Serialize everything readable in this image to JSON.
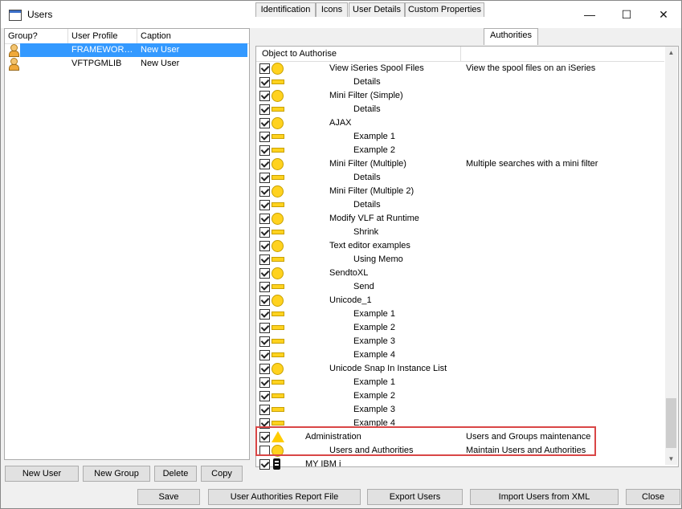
{
  "window": {
    "title": "Users",
    "minimize_glyph": "—",
    "maximize_glyph": "☐",
    "close_glyph": "✕"
  },
  "users_list": {
    "columns": [
      "Group?",
      "User Profile",
      "Caption"
    ],
    "rows": [
      {
        "profile": "FRAMEWOR…",
        "caption": "New User",
        "selected": true
      },
      {
        "profile": "VFTPGMLIB",
        "caption": "New User",
        "selected": false
      }
    ]
  },
  "left_buttons": {
    "new_user": "New User",
    "new_group": "New Group",
    "delete": "Delete",
    "copy": "Copy"
  },
  "tabs": [
    "Identification",
    "Icons",
    "User Details",
    "Custom Properties",
    "Authorities"
  ],
  "active_tab": "Authorities",
  "authorities": {
    "header": "Object to Authorise",
    "rows": [
      {
        "label": "View iSeries Spool Files",
        "desc": "View the spool files on an iSeries",
        "level": 1,
        "icon": "circle",
        "checked": true
      },
      {
        "label": "Details",
        "desc": "",
        "level": 2,
        "icon": "bar",
        "checked": true
      },
      {
        "label": "Mini Filter (Simple)",
        "desc": "",
        "level": 1,
        "icon": "circle",
        "checked": true
      },
      {
        "label": "Details",
        "desc": "",
        "level": 2,
        "icon": "bar",
        "checked": true
      },
      {
        "label": "AJAX",
        "desc": "",
        "level": 1,
        "icon": "circle",
        "checked": true
      },
      {
        "label": "Example 1",
        "desc": "",
        "level": 2,
        "icon": "bar",
        "checked": true
      },
      {
        "label": "Example 2",
        "desc": "",
        "level": 2,
        "icon": "bar",
        "checked": true
      },
      {
        "label": "Mini Filter (Multiple)",
        "desc": "Multiple searches with a mini filter",
        "level": 1,
        "icon": "circle",
        "checked": true
      },
      {
        "label": "Details",
        "desc": "",
        "level": 2,
        "icon": "bar",
        "checked": true
      },
      {
        "label": "Mini Filter (Multiple 2)",
        "desc": "",
        "level": 1,
        "icon": "circle",
        "checked": true
      },
      {
        "label": "Details",
        "desc": "",
        "level": 2,
        "icon": "bar",
        "checked": true
      },
      {
        "label": "Modify VLF at Runtime",
        "desc": "",
        "level": 1,
        "icon": "circle",
        "checked": true
      },
      {
        "label": "Shrink",
        "desc": "",
        "level": 2,
        "icon": "bar",
        "checked": true
      },
      {
        "label": "Text editor examples",
        "desc": "",
        "level": 1,
        "icon": "circle",
        "checked": true
      },
      {
        "label": "Using Memo",
        "desc": "",
        "level": 2,
        "icon": "bar",
        "checked": true
      },
      {
        "label": "SendtoXL",
        "desc": "",
        "level": 1,
        "icon": "circle",
        "checked": true
      },
      {
        "label": "Send",
        "desc": "",
        "level": 2,
        "icon": "bar",
        "checked": true
      },
      {
        "label": "Unicode_1",
        "desc": "",
        "level": 1,
        "icon": "circle",
        "checked": true
      },
      {
        "label": "Example 1",
        "desc": "",
        "level": 2,
        "icon": "bar",
        "checked": true
      },
      {
        "label": "Example 2",
        "desc": "",
        "level": 2,
        "icon": "bar",
        "checked": true
      },
      {
        "label": "Example 3",
        "desc": "",
        "level": 2,
        "icon": "bar",
        "checked": true
      },
      {
        "label": "Example 4",
        "desc": "",
        "level": 2,
        "icon": "bar",
        "checked": true
      },
      {
        "label": "Unicode Snap In Instance List",
        "desc": "",
        "level": 1,
        "icon": "circle",
        "checked": true
      },
      {
        "label": "Example 1",
        "desc": "",
        "level": 2,
        "icon": "bar",
        "checked": true
      },
      {
        "label": "Example 2",
        "desc": "",
        "level": 2,
        "icon": "bar",
        "checked": true
      },
      {
        "label": "Example 3",
        "desc": "",
        "level": 2,
        "icon": "bar",
        "checked": true
      },
      {
        "label": "Example 4",
        "desc": "",
        "level": 2,
        "icon": "bar",
        "checked": true
      },
      {
        "label": "Administration",
        "desc": "Users and Groups maintenance",
        "level": 0,
        "icon": "triangle",
        "checked": true
      },
      {
        "label": "Users and Authorities",
        "desc": "Maintain Users and Authorities",
        "level": 1,
        "icon": "circle",
        "checked": false
      },
      {
        "label": "MY IBM i",
        "desc": "",
        "level": 0,
        "icon": "server",
        "checked": true
      }
    ]
  },
  "bottom_buttons": {
    "save": "Save",
    "report": "User Authorities Report File",
    "export": "Export Users",
    "import": "Import Users from XML",
    "close": "Close"
  },
  "colors": {
    "selection": "#3399ff",
    "highlight_border": "#d94646",
    "icon_yellow": "#ffd21f"
  }
}
